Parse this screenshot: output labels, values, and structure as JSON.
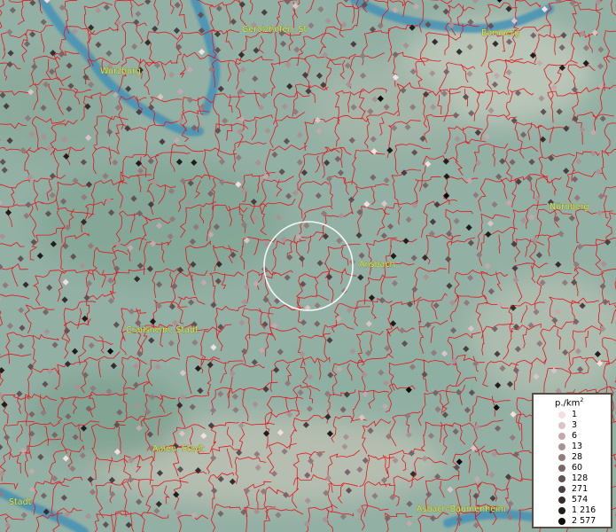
{
  "map": {
    "background_color": "#93b0a4",
    "border_color": "#e8141a",
    "water_color": "#3f8fb8",
    "places": [
      {
        "name": "Gerolzhofen, St"
      },
      {
        "name": "Bamberg"
      },
      {
        "name": "Würzburg"
      },
      {
        "name": "Nürnberg"
      },
      {
        "name": "Ansbach"
      },
      {
        "name": "Crailsheim, Stadt"
      },
      {
        "name": "Aalen, Stadt"
      },
      {
        "name": "Stadt"
      },
      {
        "name": "Asbach-Bäumenheim"
      }
    ]
  },
  "legend": {
    "unit_label": "p./km",
    "unit_power": "2",
    "classes": [
      {
        "label": "1",
        "color": "#f2dfe0"
      },
      {
        "label": "3",
        "color": "#d9c4c6"
      },
      {
        "label": "6",
        "color": "#c2aaac"
      },
      {
        "label": "13",
        "color": "#a99294"
      },
      {
        "label": "28",
        "color": "#917b7d"
      },
      {
        "label": "60",
        "color": "#7a6668"
      },
      {
        "label": "128",
        "color": "#635254"
      },
      {
        "label": "271",
        "color": "#4c3f41"
      },
      {
        "label": "574",
        "color": "#372d2e"
      },
      {
        "label": "1 216",
        "color": "#231c1d"
      },
      {
        "label": "2 577",
        "color": "#0f0b0b"
      }
    ]
  }
}
